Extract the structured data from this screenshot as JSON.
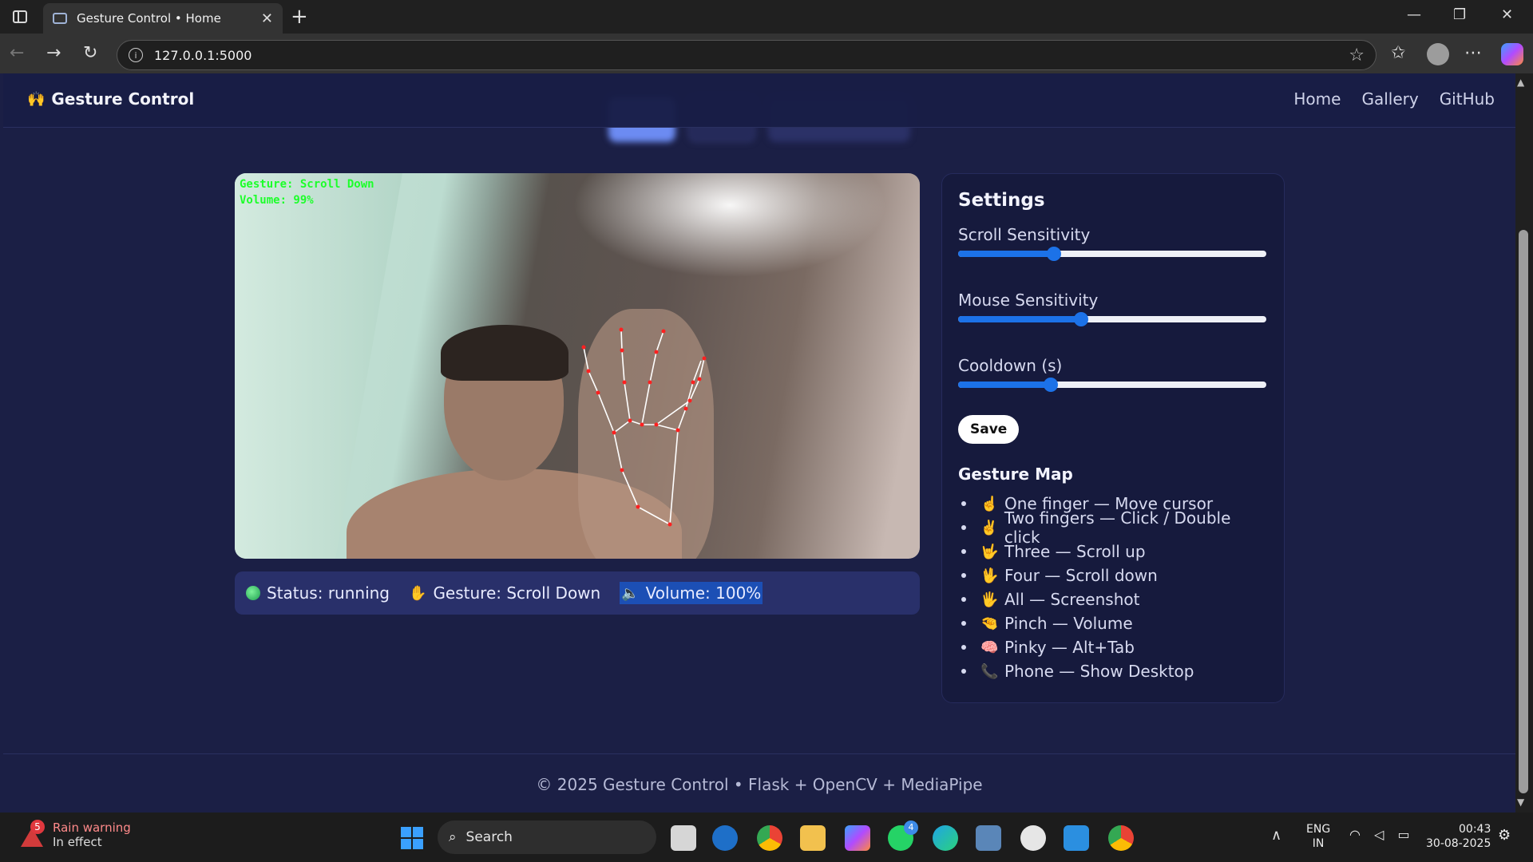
{
  "browser": {
    "tab_title": "Gesture Control • Home",
    "url": "127.0.0.1:5000"
  },
  "navbar": {
    "brand_icon": "🙌",
    "brand": "Gesture Control",
    "links": [
      "Home",
      "Gallery",
      "GitHub"
    ]
  },
  "video": {
    "overlay_gesture": "Gesture: Scroll Down",
    "overlay_volume": "Volume: 99%"
  },
  "status": {
    "status_text": "Status: running",
    "gesture_text": "Gesture: Scroll Down",
    "volume_text": "Volume: 100%",
    "gesture_emoji": "✋",
    "volume_emoji": "🔈"
  },
  "settings": {
    "title": "Settings",
    "scroll_label": "Scroll Sensitivity",
    "scroll_value": 0.31,
    "mouse_label": "Mouse Sensitivity",
    "mouse_value": 0.4,
    "cooldown_label": "Cooldown (s)",
    "cooldown_value": 0.3,
    "save_label": "Save",
    "accent": "#1c72e8"
  },
  "gesture_map": {
    "title": "Gesture Map",
    "items": [
      {
        "emoji": "☝️",
        "text": "One finger — Move cursor"
      },
      {
        "emoji": "✌️",
        "text": "Two fingers — Click / Double click"
      },
      {
        "emoji": "🤟",
        "text": "Three — Scroll up"
      },
      {
        "emoji": "🖖",
        "text": "Four — Scroll down"
      },
      {
        "emoji": "🖐️",
        "text": "All — Screenshot"
      },
      {
        "emoji": "🤏",
        "text": "Pinch — Volume"
      },
      {
        "emoji": "🧠",
        "text": "Pinky — Alt+Tab"
      },
      {
        "emoji": "📞",
        "text": "Phone — Show Desktop"
      }
    ]
  },
  "footer": {
    "text": "© 2025 Gesture Control • Flask + OpenCV + MediaPipe"
  },
  "taskbar": {
    "weather_count": "5",
    "weather_title": "Rain warning",
    "weather_sub": "In effect",
    "search_label": "Search",
    "whatsapp_badge": "4",
    "lang_line1": "ENG",
    "lang_line2": "IN",
    "time": "00:43",
    "date": "30-08-2025"
  }
}
